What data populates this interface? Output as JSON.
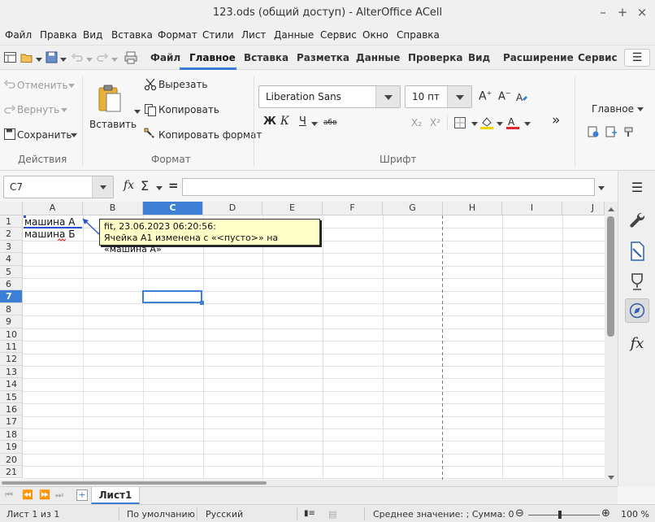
{
  "window": {
    "title": "123.ods (общий доступ) - AlterOffice ACell",
    "controls": {
      "minimize": "–",
      "maximize": "+",
      "close": "×"
    }
  },
  "menu": [
    "Файл",
    "Правка",
    "Вид",
    "Вставка",
    "Формат",
    "Стили",
    "Лист",
    "Данные",
    "Сервис",
    "Окно",
    "Справка"
  ],
  "tabs": [
    "Файл",
    "Главное",
    "Вставка",
    "Разметка",
    "Данные",
    "Проверка",
    "Вид",
    "Расширение",
    "Сервис"
  ],
  "active_tab": "Главное",
  "ribbon": {
    "undo": "Отменить",
    "redo": "Вернуть",
    "save": "Сохранить",
    "group_actions": "Действия",
    "paste": "Вставить",
    "cut": "Вырезать",
    "copy": "Копировать",
    "copy_format": "Копировать формат",
    "group_format": "Формат",
    "font_name": "Liberation Sans",
    "font_size": "10 пт",
    "bold": "Ж",
    "italic": "К",
    "underline": "Ч",
    "strike": "абв",
    "subscript": "X₂",
    "superscript": "X²",
    "group_font": "Шрифт",
    "style": "Главное",
    "more": "»"
  },
  "formula_bar": {
    "name_box": "C7",
    "fx": "fx",
    "sigma": "Σ",
    "equals": "=",
    "value": ""
  },
  "grid": {
    "columns": [
      "A",
      "B",
      "C",
      "D",
      "E",
      "F",
      "G",
      "H",
      "I",
      "J"
    ],
    "rows": [
      "1",
      "2",
      "3",
      "4",
      "5",
      "6",
      "7",
      "8",
      "9",
      "10",
      "11",
      "12",
      "13",
      "14",
      "15",
      "16",
      "17",
      "18",
      "19",
      "20",
      "21"
    ],
    "selected_column": "C",
    "selected_row": "7",
    "cells": {
      "A1": "машина А",
      "A2": "машина Б"
    }
  },
  "comment": {
    "header": "fit, 23.06.2023 06:20:56:",
    "body": "Ячейка A1 изменена с «<пусто>» на «машина А»"
  },
  "sheets": [
    "Лист1"
  ],
  "status": {
    "sheet": "Лист 1 из 1",
    "style": "По умолчанию",
    "language": "Русский",
    "summary": "Среднее значение: ; Сумма: 0",
    "zoom": "100 %",
    "zoom_fraction": 0.5
  },
  "colors": {
    "accent": "#3d7fd5",
    "tooltip_bg": "#ffffc8",
    "highlight": "#f5d300",
    "font_color": "#e0242a"
  }
}
